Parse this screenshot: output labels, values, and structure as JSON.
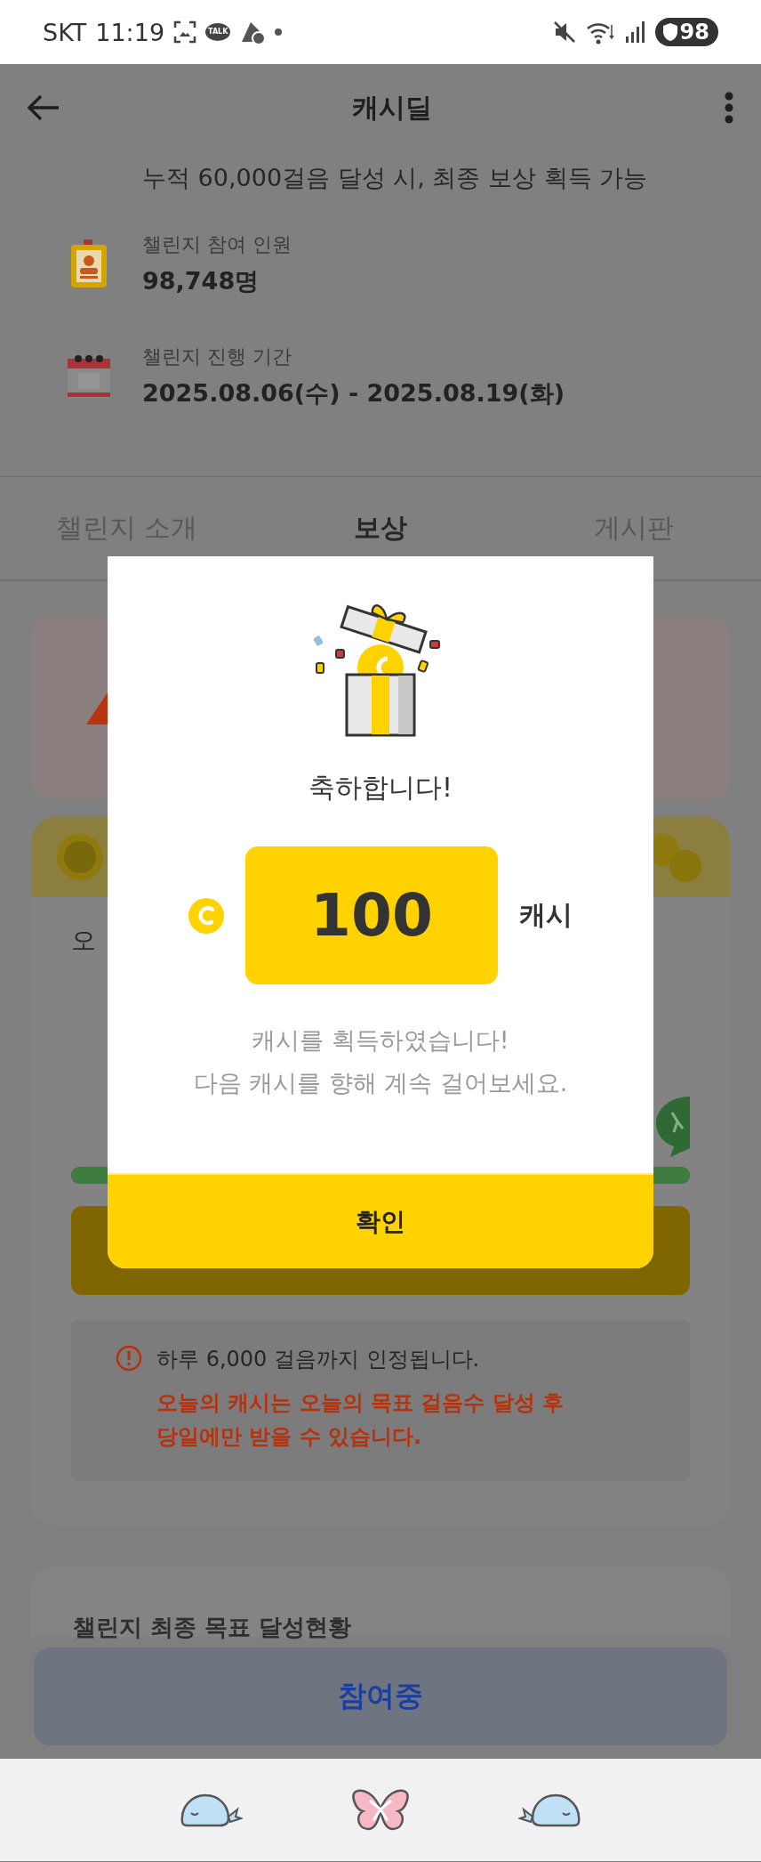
{
  "status_bar": {
    "carrier": "SKT",
    "time": "11:19",
    "chat_app_label": "TALK",
    "battery": "98"
  },
  "app_bar": {
    "title": "캐시딜"
  },
  "challenge": {
    "goal_text": "누적 60,000걸음 달성 시, 최종 보상 획득 가능",
    "stats": [
      {
        "kind": "participants",
        "label": "챌린지 참여 인원",
        "value": "98,748명"
      },
      {
        "kind": "period",
        "label": "챌린지 진행 기간",
        "value": "2025.08.06(수) - 2025.08.19(화)"
      }
    ]
  },
  "tabs": [
    {
      "label": "챌린지 소개",
      "selected": false
    },
    {
      "label": "보상",
      "selected": true
    },
    {
      "label": "게시판",
      "selected": false
    }
  ],
  "today_card": {
    "title": "오",
    "progress": {
      "level": 1
    },
    "notice": "하루 6,000 걸음까지 인정됩니다.",
    "warning": "오늘의 캐시는 오늘의 목표 걸음수 달성 후 당일에만 받을 수 있습니다."
  },
  "final_goal_card": {
    "title": "챌린지 최종 목표 달성현황"
  },
  "join_button": {
    "label": "참여중"
  },
  "modal": {
    "heading": "축하합니다!",
    "amount": "100",
    "unit": "캐시",
    "message_lines": [
      "캐시를 획득하였습니다!",
      "다음 캐시를 향해 계속 걸어보세요."
    ],
    "confirm": "확인"
  }
}
